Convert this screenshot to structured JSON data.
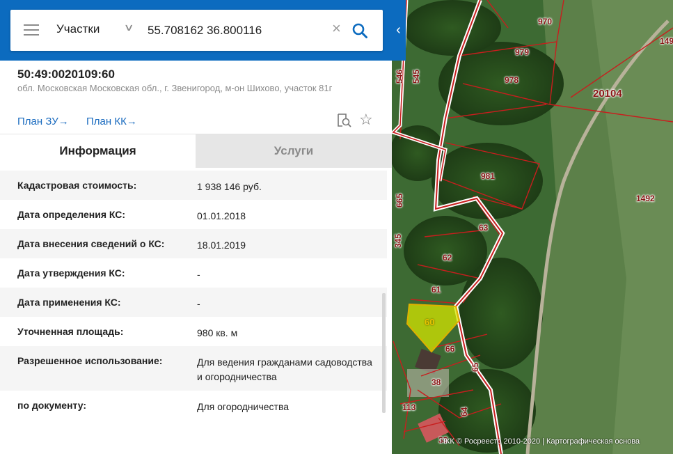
{
  "search": {
    "category": "Участки",
    "query": "55.708162 36.800116"
  },
  "parcel": {
    "cadastral_number": "50:49:0020109:60",
    "address": "обл. Московская Московская обл., г. Звенигород, м-он Шихово, участок 81г"
  },
  "links": {
    "plan_zu": "План ЗУ",
    "plan_kk": "План КК",
    "arrow": "→"
  },
  "tabs": {
    "info": "Информация",
    "services": "Услуги"
  },
  "info_rows": [
    {
      "label": "Кадастровая стоимость:",
      "value": "1 938 146 руб."
    },
    {
      "label": "Дата определения КС:",
      "value": "01.01.2018"
    },
    {
      "label": "Дата внесения сведений о КС:",
      "value": "18.01.2019"
    },
    {
      "label": "Дата утверждения КС:",
      "value": "-"
    },
    {
      "label": "Дата применения КС:",
      "value": "-"
    },
    {
      "label": "Уточненная площадь:",
      "value": "980 кв. м"
    },
    {
      "label": "Разрешенное использование:",
      "value": "Для ведения гражданами садоводства и огородничества"
    },
    {
      "label": "по документу:",
      "value": "Для огородничества"
    }
  ],
  "map": {
    "labels": {
      "l970": "970",
      "l979": "979",
      "l978": "978",
      "l20104": "20104",
      "l149": "149",
      "l981": "981",
      "l1492": "1492",
      "l63": "63",
      "l62": "62",
      "l61": "61",
      "l60": "60",
      "l66": "66",
      "l65": "65",
      "l38": "38",
      "l64": "64",
      "l113": "113",
      "l33": "33",
      "l546": "546",
      "l545": "545",
      "l665": "665",
      "l345": "345"
    },
    "copyright": "ПКК © Росреестр 2010-2020 | Картографическая основа"
  },
  "colors": {
    "brand": "#0c6bbf",
    "link": "#1a6bbf",
    "parcel_border": "#c81e1e",
    "selected_fill": "#d4e600"
  }
}
